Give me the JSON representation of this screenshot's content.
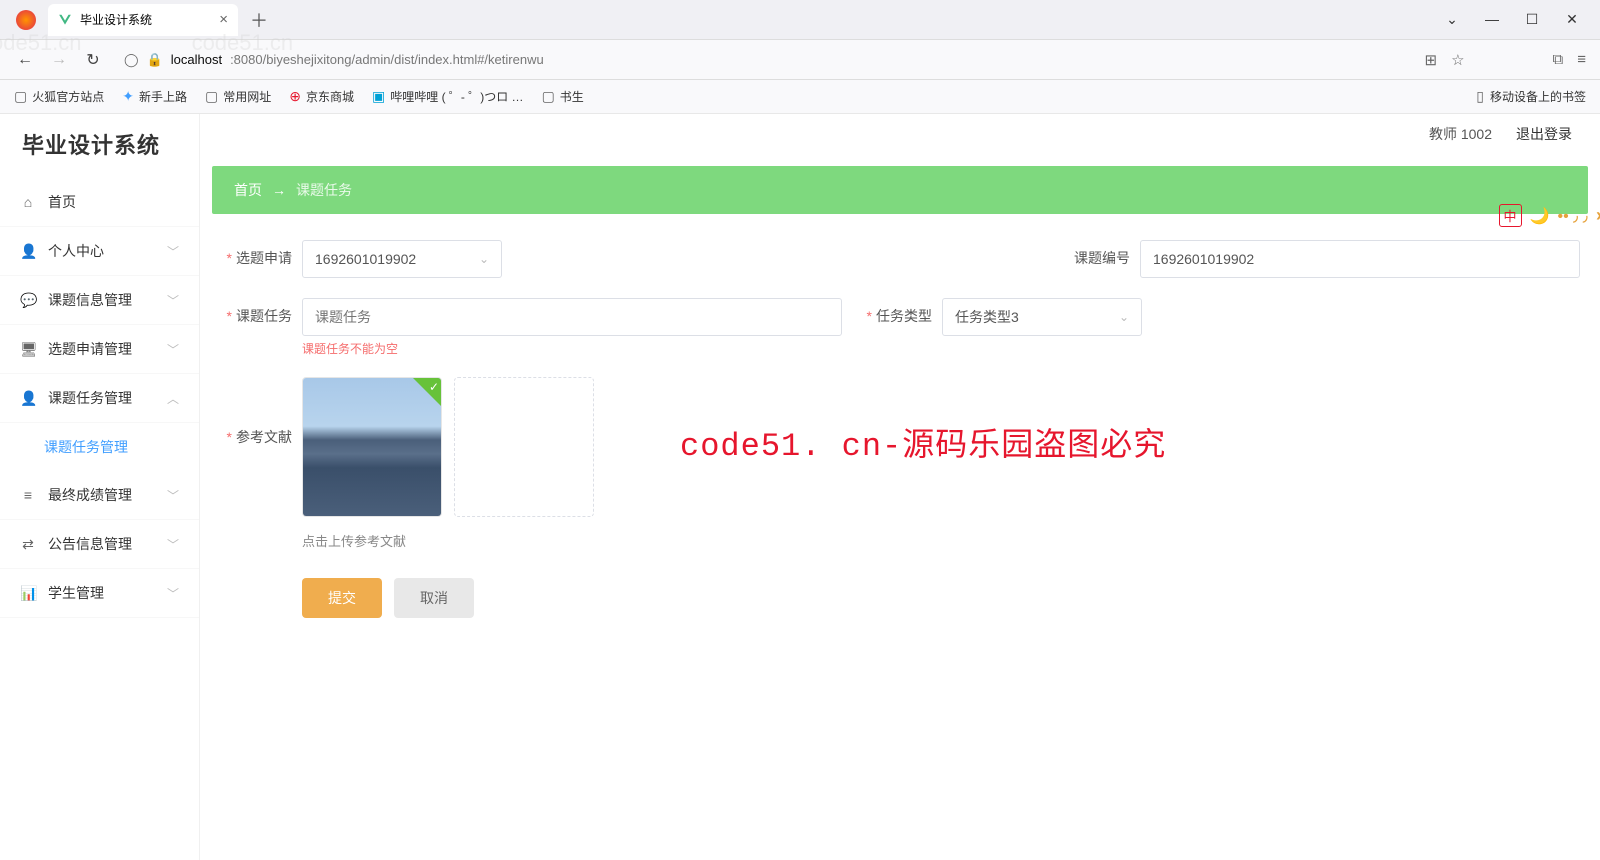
{
  "browser": {
    "tab_title": "毕业设计系统",
    "url_host": "localhost",
    "url_port_path": ":8080/biyeshejixitong/admin/dist/index.html#/ketirenwu"
  },
  "bookmarks": {
    "items": [
      "火狐官方站点",
      "新手上路",
      "常用网址",
      "京东商城",
      "哔哩哔哩 ( ゜- ゜)つロ …",
      "书生"
    ],
    "mobile": "移动设备上的书签"
  },
  "app": {
    "title": "毕业设计系统",
    "user_role": "教师",
    "user_id": "1002",
    "logout": "退出登录"
  },
  "menu": {
    "home": "首页",
    "personal": "个人中心",
    "topic_info": "课题信息管理",
    "apply": "选题申请管理",
    "task": "课题任务管理",
    "task_sub": "课题任务管理",
    "grade": "最终成绩管理",
    "notice": "公告信息管理",
    "student": "学生管理"
  },
  "breadcrumb": {
    "home": "首页",
    "arrow": "→",
    "current": "课题任务"
  },
  "form": {
    "apply_label": "选题申请",
    "apply_value": "1692601019902",
    "topic_id_label": "课题编号",
    "topic_id_value": "1692601019902",
    "task_label": "课题任务",
    "task_placeholder": "课题任务",
    "task_error": "课题任务不能为空",
    "task_type_label": "任务类型",
    "task_type_value": "任务类型3",
    "ref_label": "参考文献",
    "upload_tip": "点击上传参考文献",
    "submit": "提交",
    "cancel": "取消"
  },
  "watermark": {
    "main": "code51. cn-源码乐园盗图必究",
    "bg": "code51.cn"
  }
}
